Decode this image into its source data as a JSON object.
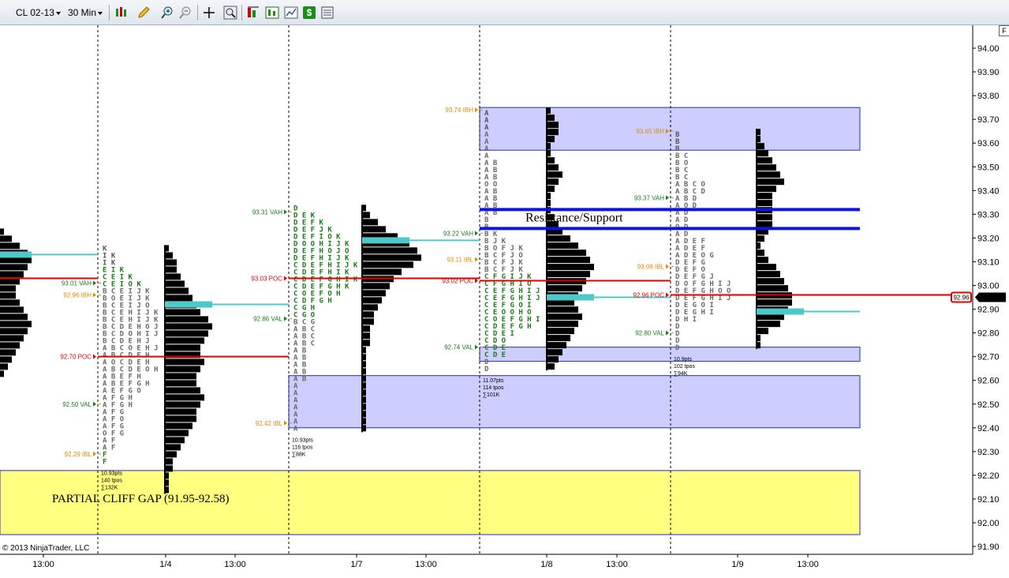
{
  "toolbar": {
    "instrument": "CL 02-13",
    "interval": "30 Min",
    "icons": [
      "bar-type-icon",
      "pencil-icon",
      "zoom-in-icon",
      "zoom-out-icon",
      "crosshair-icon",
      "magnifier-icon",
      "indicators-icon",
      "strategy-icon",
      "chart-style-icon",
      "dollar-icon",
      "properties-icon"
    ]
  },
  "copyright": "© 2013 NinjaTrader, LLC",
  "f_button": "F",
  "colors": {
    "resistance": "#0a14e6",
    "poc": "#e00000",
    "va_bar": "#4ec9c9",
    "profile": "#000000",
    "zone": "#c8c8ff",
    "gap": "#ffff80",
    "vah": "#1b7a1b",
    "ib": "#e08a00"
  },
  "chart_data": {
    "type": "market-profile",
    "y_axis": {
      "min": 91.9,
      "max": 94.0,
      "ticks": [
        "94.00",
        "93.90",
        "93.80",
        "93.70",
        "93.60",
        "93.50",
        "93.40",
        "93.30",
        "93.20",
        "93.10",
        "93.00",
        "92.90",
        "92.80",
        "92.70",
        "92.60",
        "92.50",
        "92.40",
        "92.30",
        "92.20",
        "92.10",
        "92.00",
        "91.90"
      ]
    },
    "x_axis": {
      "ticks": [
        "13:00",
        "1/4",
        "13:00",
        "1/7",
        "13:00",
        "1/8",
        "13:00",
        "1/9",
        "13:00"
      ]
    },
    "current_price": "92.95",
    "last_poc_tag": "92.96",
    "annotations": {
      "resistance_label": "Resistance/Support",
      "resistance_levels": [
        93.32,
        93.24
      ],
      "gap_label": "PARTIAL CLIFF GAP (91.95-92.58)",
      "gap_range": [
        91.95,
        92.22
      ]
    },
    "zones": [
      {
        "from": 92.4,
        "to": 92.62,
        "session": "1/7"
      },
      {
        "from": 93.57,
        "to": 93.75,
        "session": "1/8"
      },
      {
        "from": 92.68,
        "to": 92.74,
        "session": "1/8"
      }
    ],
    "sessions": [
      {
        "name": "1/4",
        "levels": [
          {
            "label": "93.01 VAH",
            "price": 93.01,
            "kind": "vah"
          },
          {
            "label": "92.96 IBH",
            "price": 92.96,
            "kind": "ib"
          },
          {
            "label": "92.70 POC",
            "price": 92.7,
            "kind": "poc"
          },
          {
            "label": "92.50 VAL",
            "price": 92.5,
            "kind": "vah"
          },
          {
            "label": "92.29 IBL",
            "price": 92.29,
            "kind": "ib"
          }
        ],
        "tpo_top": 93.17,
        "tpo_rows": [
          "K",
          "I K",
          "I K",
          "E I K",
          "C E I K",
          "C E I O K",
          "B C E I J K",
          "B O E I J K",
          "B C E I J O",
          "B C E H I J K",
          "B C E H I J K",
          "B C D E H O J",
          "B C D O H I J",
          "B C D E H J",
          "A B C O E H J",
          "A B C D E H",
          "A O C D E H",
          "A B C D E O H",
          "A B E F H",
          "A B E F G H",
          "A E F G O",
          "A F G H",
          "A F G H",
          "A F G",
          "A F O",
          "A F G",
          "O F G",
          "A F",
          "A F",
          "F",
          "F"
        ],
        "stats": [
          "10.93pts",
          "140 tpos",
          "∑132K"
        ],
        "profile_top": 93.17,
        "profile": [
          1,
          2,
          3,
          3,
          4,
          5,
          6,
          7,
          8,
          9,
          11,
          12,
          11,
          10,
          9,
          9,
          10,
          9,
          8,
          8,
          9,
          10,
          9,
          8,
          8,
          7,
          6,
          5,
          4,
          3,
          2,
          2,
          1,
          1,
          1
        ],
        "va_price": 92.92,
        "poc_price": 92.7
      },
      {
        "name": "1/7",
        "levels": [
          {
            "label": "93.31 VAH",
            "price": 93.31,
            "kind": "vah"
          },
          {
            "label": "93.03 POC",
            "price": 93.03,
            "kind": "poc"
          },
          {
            "label": "92.86 VAL",
            "price": 92.86,
            "kind": "vah"
          },
          {
            "label": "92.42 IBL",
            "price": 92.42,
            "kind": "ib"
          }
        ],
        "tpo_top": 93.34,
        "tpo_rows": [
          "D",
          "D E K",
          "D E F K",
          "D E F J K",
          "D E F I O K",
          "D O O H I J K",
          "D E F H O J O",
          "D E F H I J K",
          "C D E F H I J K",
          "C D E F H I K",
          "C D E F G H I K",
          "C D E F G H K",
          "C O E F O H",
          "C D F G H",
          "C G H",
          "C G O",
          "B C G",
          "A B C",
          "A B C",
          "A B C",
          "A B",
          "A B",
          "A B",
          "A B",
          "A B",
          "A",
          "A",
          "A",
          "A",
          "A",
          "A",
          "A"
        ],
        "stats": [
          "10.93pts",
          "116 tpos",
          "∑88K"
        ],
        "profile_top": 93.34,
        "profile": [
          1,
          2,
          4,
          6,
          9,
          12,
          14,
          15,
          13,
          10,
          8,
          7,
          6,
          5,
          4,
          3,
          3,
          2,
          2,
          2,
          1,
          1,
          1,
          1,
          1,
          1,
          1,
          1,
          1,
          1,
          1,
          1
        ],
        "va_price": 93.19,
        "poc_price": 93.03
      },
      {
        "name": "1/8",
        "levels": [
          {
            "label": "93.74 IBH",
            "price": 93.74,
            "kind": "ib"
          },
          {
            "label": "93.22 VAH",
            "price": 93.22,
            "kind": "vah"
          },
          {
            "label": "93.11 IBL",
            "price": 93.11,
            "kind": "ib"
          },
          {
            "label": "93.02 POC",
            "price": 93.02,
            "kind": "poc"
          },
          {
            "label": "92.74 VAL",
            "price": 92.74,
            "kind": "vah"
          }
        ],
        "tpo_top": 93.74,
        "tpo_rows": [
          "A",
          "A",
          "A",
          "A",
          "A",
          "A",
          "A",
          "A B",
          "A B",
          "A B",
          "O O",
          "A B",
          "A B",
          "A B",
          "A B",
          "B",
          "B",
          "B K",
          "B J K",
          "B O F J K",
          "B C F J O",
          "B C F J K",
          "B C F J K",
          "C F G I J K",
          "C F G H I O",
          "C E F G H I J",
          "C E F G H I J",
          "C E F G O I",
          "C E O O H O",
          "C O E F G H I",
          "C D E F G H",
          "C D E I",
          "C D O",
          "C D E",
          "C D E",
          "D",
          "D"
        ],
        "stats": [
          "11.07pts",
          "114 tpos",
          "∑101K"
        ],
        "profile_top": 93.75,
        "profile": [
          1,
          2,
          3,
          3,
          2,
          1,
          1,
          2,
          3,
          4,
          3,
          2,
          1,
          1,
          1,
          2,
          3,
          4,
          6,
          8,
          10,
          11,
          12,
          11,
          10,
          9,
          8,
          7,
          8,
          9,
          8,
          7,
          6,
          5,
          4,
          3,
          2
        ],
        "va_price": 92.95,
        "poc_price": 93.02
      },
      {
        "name": "1/9",
        "levels": [
          {
            "label": "93.65 IBH",
            "price": 93.65,
            "kind": "ib"
          },
          {
            "label": "93.37 VAH",
            "price": 93.37,
            "kind": "vah"
          },
          {
            "label": "93.08 IBL",
            "price": 93.08,
            "kind": "ib"
          },
          {
            "label": "92.96 POC",
            "price": 92.96,
            "kind": "poc"
          },
          {
            "label": "92.80 VAL",
            "price": 92.8,
            "kind": "vah"
          }
        ],
        "tpo_top": 93.65,
        "tpo_rows": [
          "B",
          "B",
          "B",
          "B C",
          "B O",
          "B C",
          "B C",
          "A B C O",
          "A B C D",
          "A B D",
          "A O D",
          "A D",
          "A D",
          "O D",
          "A D",
          "A D E F",
          "A D E F",
          "A D E O G",
          "D E F G",
          "D E F O",
          "D E F G J",
          "D O F G H I J",
          "D E F G H O O",
          "D E F G H I J",
          "D E G O I",
          "D E G H I",
          "D H I",
          "D",
          "D",
          "D",
          "D"
        ],
        "stats": [
          "10.9pts",
          "102 tpos",
          "∑94K"
        ],
        "profile_top": 93.66,
        "profile": [
          1,
          1,
          2,
          3,
          4,
          5,
          6,
          7,
          5,
          4,
          4,
          4,
          4,
          4,
          3,
          2,
          1,
          2,
          3,
          5,
          6,
          7,
          8,
          9,
          9,
          8,
          7,
          6,
          3,
          1,
          1
        ],
        "va_price": 92.89,
        "poc_price": 92.96
      }
    ]
  }
}
